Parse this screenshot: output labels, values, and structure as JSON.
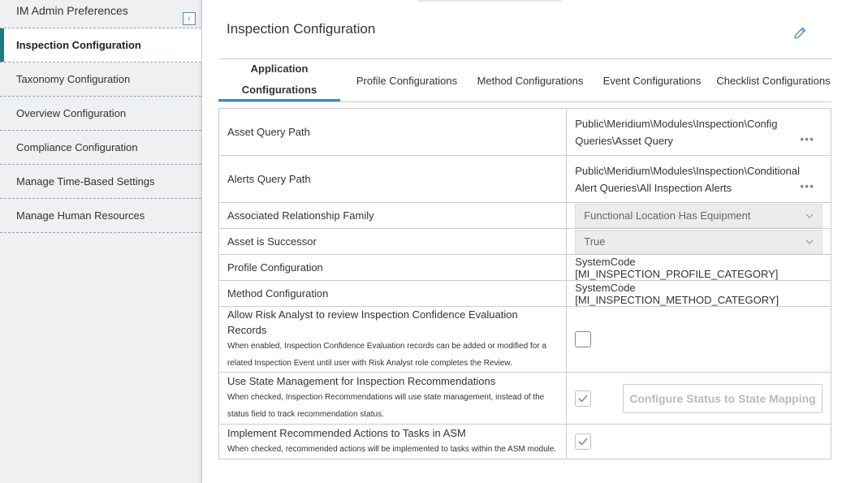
{
  "sidebar": {
    "header": "IM Admin Preferences",
    "collapse_glyph": "‹",
    "items": [
      {
        "label": "Inspection Configuration"
      },
      {
        "label": "Taxonomy Configuration"
      },
      {
        "label": "Overview Configuration"
      },
      {
        "label": "Compliance Configuration"
      },
      {
        "label": "Manage Time-Based Settings"
      },
      {
        "label": "Manage Human Resources"
      }
    ]
  },
  "main": {
    "title": "Inspection Configuration",
    "edit_icon": "pencil-icon",
    "tabs": [
      {
        "label": "Application Configurations",
        "active": true
      },
      {
        "label": "Profile Configurations"
      },
      {
        "label": "Method Configurations"
      },
      {
        "label": "Event Configurations"
      },
      {
        "label": "Checklist Configurations"
      }
    ]
  },
  "rows": {
    "asset_query": {
      "label": "Asset Query Path",
      "value": "Public\\Meridium\\Modules\\Inspection\\Config Queries\\Asset Query",
      "more": "•••"
    },
    "alerts_query": {
      "label": "Alerts Query Path",
      "value": "Public\\Meridium\\Modules\\Inspection\\Conditional Alert Queries\\All Inspection Alerts",
      "more": "•••"
    },
    "relationship_family": {
      "label": "Associated Relationship Family",
      "value": "Functional Location Has Equipment"
    },
    "asset_successor": {
      "label": "Asset is Successor",
      "value": "True"
    },
    "profile_config": {
      "label": "Profile Configuration",
      "value": "SystemCode [MI_INSPECTION_PROFILE_CATEGORY]"
    },
    "method_config": {
      "label": "Method Configuration",
      "value": "SystemCode [MI_INSPECTION_METHOD_CATEGORY]"
    },
    "risk_analyst": {
      "label": "Allow Risk Analyst to review Inspection Confidence Evaluation Records",
      "sub": "When enabled, Inspection Confidence Evaluation records can be added or modified for a related Inspection Event until user with Risk Analyst role completes the Review.",
      "checked": false
    },
    "state_mgmt": {
      "label": "Use State Management for Inspection Recommendations",
      "sub": "When checked, Inspection Recommendations will use state management, instead of the status field to track recommendation status.",
      "checked": true,
      "button": "Configure Status to State Mapping"
    },
    "asm_tasks": {
      "label": "Implement Recommended Actions to Tasks in ASM",
      "sub": "When checked, recommended actions will be implemented to tasks within the ASM module.",
      "checked": true
    }
  },
  "colors": {
    "accent": "#3a86d6",
    "active_marker": "#1b7a8a"
  }
}
